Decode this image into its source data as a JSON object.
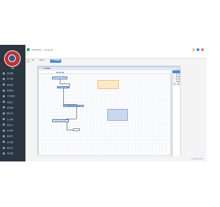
{
  "header": {
    "title": "ERP管理系统 · 工作流设计器",
    "icon_colors": [
      "#f2c037",
      "#3f8edb",
      "#e05c5c"
    ]
  },
  "tabs": [
    {
      "label": "首页",
      "active": false
    },
    {
      "label": "流程设计",
      "active": false
    },
    {
      "label": "工作流编辑器",
      "active": true
    }
  ],
  "sidebar": {
    "logo_text": "ERP",
    "items": [
      {
        "label": "系统管理",
        "icon": "settings-icon"
      },
      {
        "label": "用户管理",
        "icon": "user-icon"
      },
      {
        "label": "角色管理",
        "icon": "role-icon"
      },
      {
        "label": "权限管理",
        "icon": "lock-icon"
      },
      {
        "label": "工作流管理",
        "icon": "flow-icon"
      },
      {
        "label": "流程设计",
        "icon": "design-icon"
      },
      {
        "label": "表单管理",
        "icon": "form-icon"
      },
      {
        "label": "数据字典",
        "icon": "book-icon"
      },
      {
        "label": "日志管理",
        "icon": "log-icon"
      },
      {
        "label": "消息中心",
        "icon": "message-icon"
      },
      {
        "label": "任务管理",
        "icon": "task-icon"
      },
      {
        "label": "报表统计",
        "icon": "chart-icon"
      },
      {
        "label": "文件管理",
        "icon": "file-icon"
      },
      {
        "label": "通知公告",
        "icon": "bell-icon"
      },
      {
        "label": "系统设置",
        "icon": "gear-icon"
      }
    ]
  },
  "dialog": {
    "title": "工作流编辑器",
    "close": "×",
    "nodes": [
      "SELECT_ACT_START",
      "SELECT_ACT_TASK1",
      "SELECT_ACT_TASK2",
      "SELECT_ACT_END"
    ],
    "notes": {
      "yellow": "",
      "blue": ""
    },
    "props": {
      "rows": [
        {
          "label": "名称",
          "value": "SELECT_ACT"
        },
        {
          "label": "类型",
          "value": "用户任务"
        },
        {
          "label": "处理人",
          "value": "张三"
        },
        {
          "label": "期限",
          "value": "3天"
        }
      ],
      "save": "保存",
      "cancel": "取消"
    }
  },
  "footer": "© 2018 ERP 工作流"
}
